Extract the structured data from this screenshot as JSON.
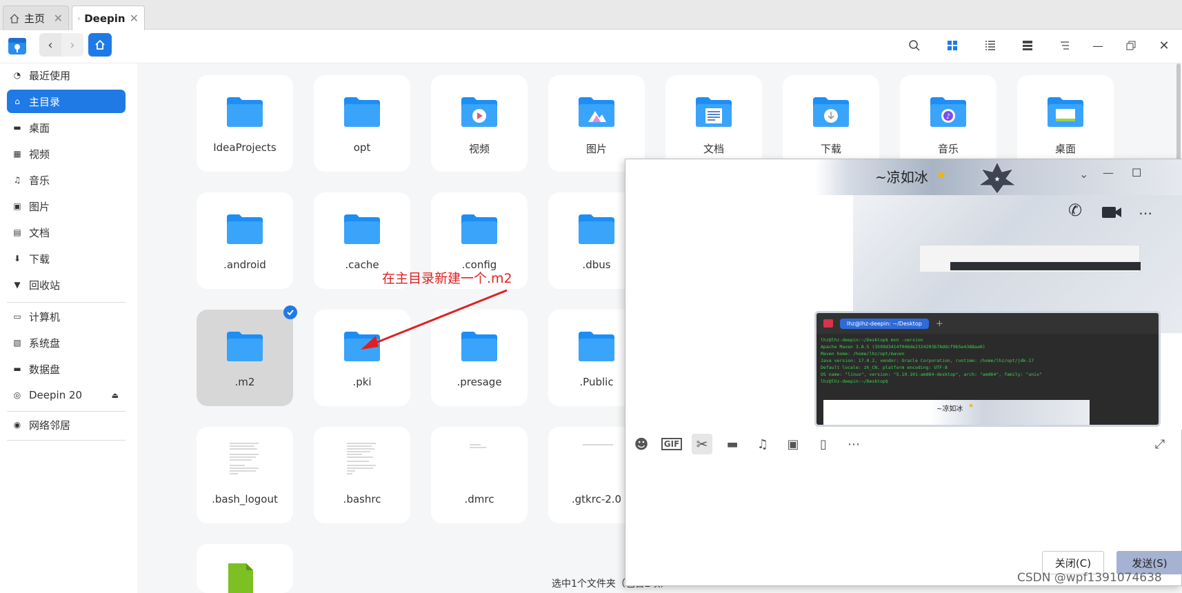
{
  "tabs": [
    {
      "label": "主页",
      "icon": "home-icon"
    },
    {
      "label": "Deepin",
      "icon": "terminal-icon"
    }
  ],
  "sidebar": {
    "items": [
      {
        "label": "最近使用",
        "icon": "clock-icon"
      },
      {
        "label": "主目录",
        "icon": "home-icon",
        "active": true
      },
      {
        "label": "桌面",
        "icon": "desktop-icon"
      },
      {
        "label": "视频",
        "icon": "video-icon"
      },
      {
        "label": "音乐",
        "icon": "music-icon"
      },
      {
        "label": "图片",
        "icon": "image-icon"
      },
      {
        "label": "文档",
        "icon": "document-icon"
      },
      {
        "label": "下载",
        "icon": "download-icon"
      },
      {
        "label": "回收站",
        "icon": "trash-icon"
      }
    ],
    "devices": [
      {
        "label": "计算机",
        "icon": "computer-icon"
      },
      {
        "label": "系统盘",
        "icon": "disk-icon"
      },
      {
        "label": "数据盘",
        "icon": "disk-icon"
      },
      {
        "label": "Deepin 20",
        "icon": "disc-icon"
      }
    ],
    "network": {
      "label": "网络邻居",
      "icon": "network-icon"
    }
  },
  "files": {
    "row1": [
      "IdeaProjects",
      "opt",
      "视频",
      "图片",
      "文档",
      "下载",
      "音乐",
      "桌面"
    ],
    "row2": [
      ".android",
      ".cache",
      ".config",
      ".dbus"
    ],
    "row3": [
      ".m2",
      ".pki",
      ".presage",
      ".Public"
    ],
    "row4": [
      ".bash_logout",
      ".bashrc",
      ".dmrc",
      ".gtkrc-2.0"
    ]
  },
  "annotation": "在主目录新建一个.m2",
  "status": "选中1个文件夹（包含2项）",
  "chat": {
    "contact_name": "~凉如冰",
    "terminal_tab": "lhz@lhz-deepin: ~/Desktop",
    "terminal_lines": [
      "lhz@lhz-deepin:~/Desktop$ mvn -version",
      "Apache Maven 3.8.5 (3599d3414f046de2324203b78ddcf9b5e4388aa0)",
      "Maven home: /home/lhz/opt/maven",
      "Java version: 17.0.2, vendor: Oracle Corporation, runtime: /home/lhz/opt/jdk-17",
      "Default locale: zh_CN, platform encoding: UTF-8",
      "OS name: \"linux\", version: \"5.10.101-amd64-desktop\", arch: \"amd64\", family: \"unix\"",
      "lhz@lhz-deepin:~/Desktop$"
    ],
    "close_label": "关闭(C)",
    "send_label": "发送(S)"
  },
  "watermark": "CSDN @wpf1391074638"
}
